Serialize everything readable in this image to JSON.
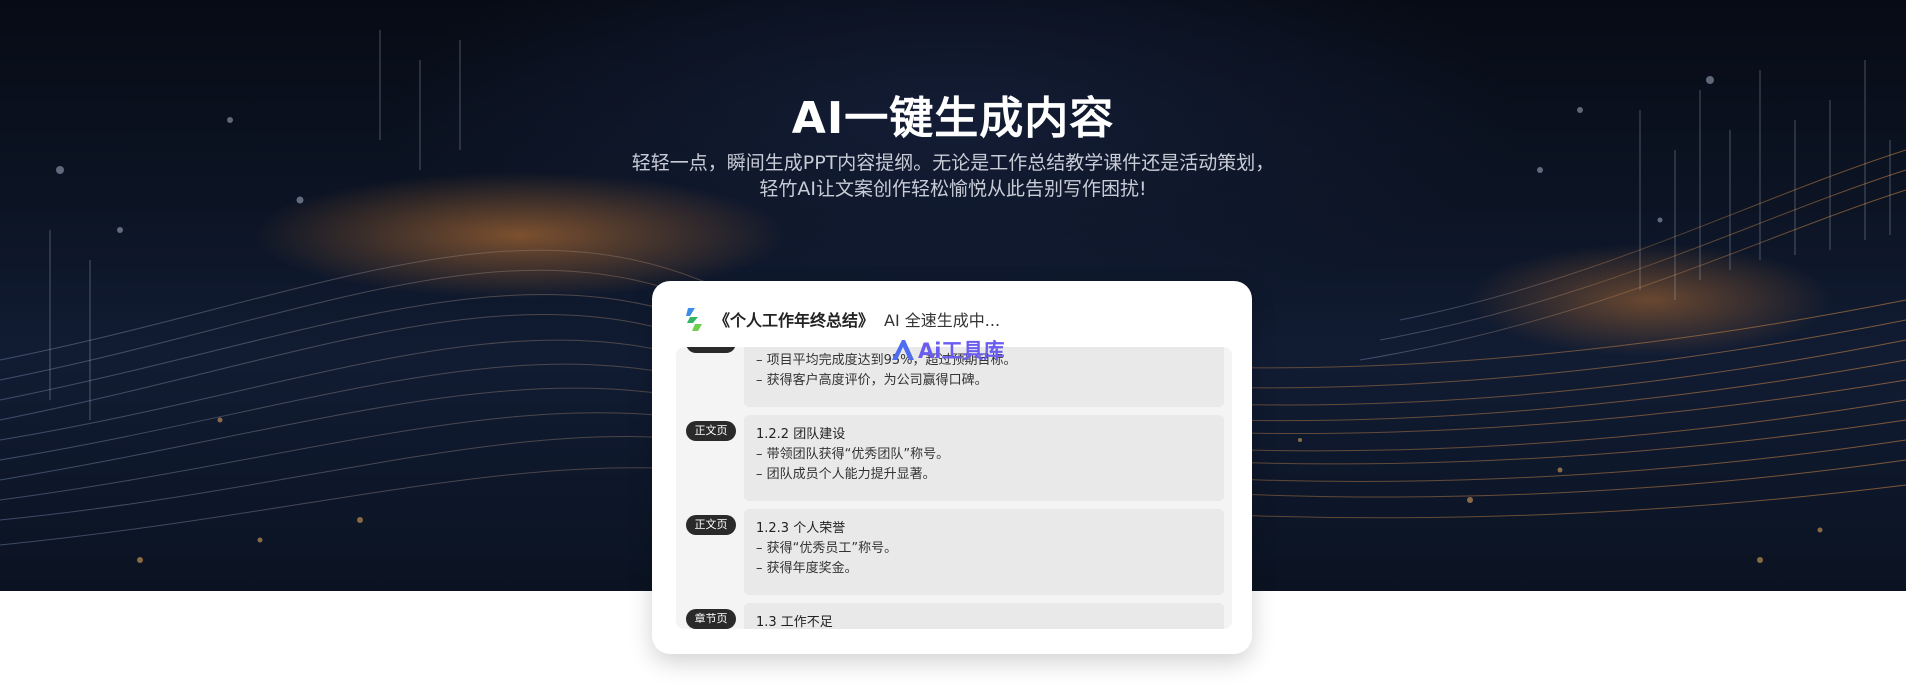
{
  "hero": {
    "title": "AI一键生成内容",
    "desc_line1": "轻轻一点，瞬间生成PPT内容提纲。无论是工作总结教学课件还是活动策划，",
    "desc_line2": "轻竹AI让文案创作轻松愉悦从此告别写作困扰!"
  },
  "card": {
    "logo_icon": "bamboo-logo-icon",
    "doc_title": "《个人工作年终总结》",
    "status": "AI 全速生成中...",
    "watermark": "Ai工具库",
    "outline": [
      {
        "tag": "",
        "heading": "",
        "lines": [
          "– 项目平均完成度达到95%，超过预期目标。",
          "– 获得客户高度评价，为公司赢得口碑。"
        ]
      },
      {
        "tag": "正文页",
        "heading": "1.2.2 团队建设",
        "lines": [
          "– 带领团队获得“优秀团队”称号。",
          "– 团队成员个人能力提升显著。"
        ]
      },
      {
        "tag": "正文页",
        "heading": "1.2.3 个人荣誉",
        "lines": [
          "– 获得“优秀员工”称号。",
          "– 获得年度奖金。"
        ]
      },
      {
        "tag": "章节页",
        "heading": "1.3 工作不足",
        "lines": []
      }
    ]
  },
  "colors": {
    "watermark": "#6b5cf0",
    "tag_bg": "#2a2a2a",
    "hero_glow": "#d68034"
  }
}
